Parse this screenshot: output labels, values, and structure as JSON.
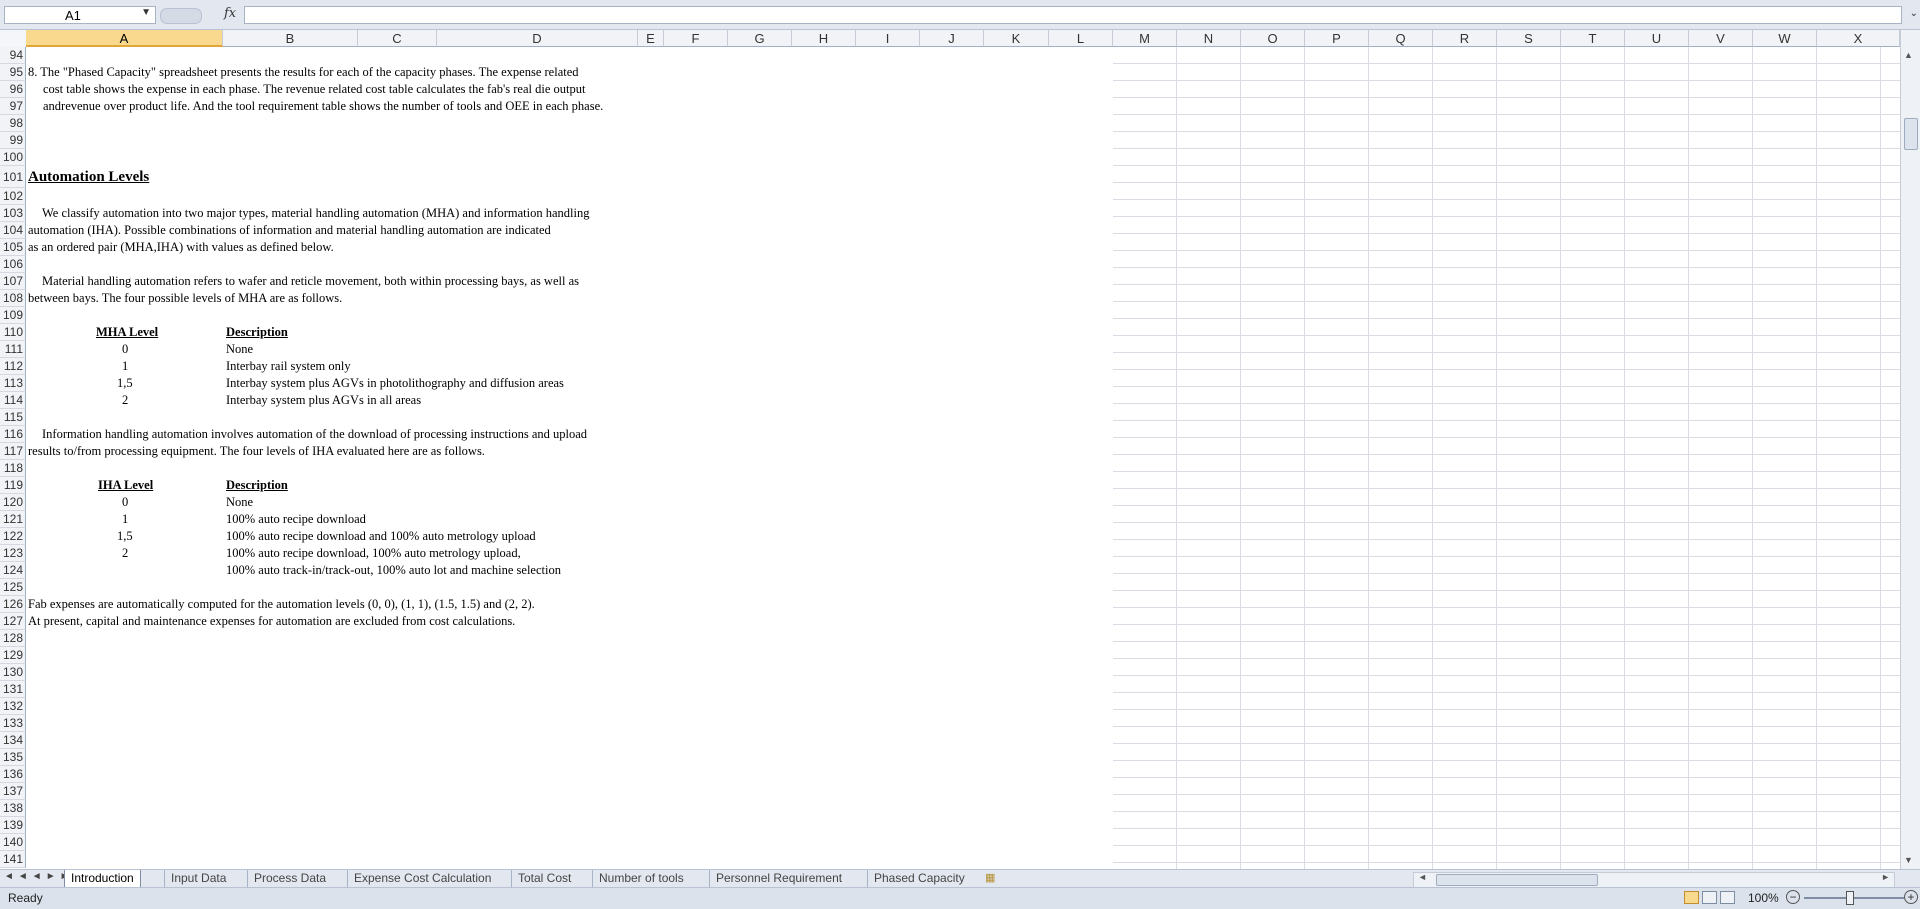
{
  "formula_bar": {
    "name_box": "A1",
    "fx": "fx",
    "formula": ""
  },
  "columns": [
    "A",
    "B",
    "C",
    "D",
    "E",
    "F",
    "G",
    "H",
    "I",
    "J",
    "K",
    "L",
    "M",
    "N",
    "O",
    "P",
    "Q",
    "R",
    "S",
    "T",
    "U",
    "V",
    "W",
    "X"
  ],
  "rows": [
    "94",
    "95",
    "96",
    "97",
    "98",
    "99",
    "100",
    "101",
    "102",
    "103",
    "104",
    "105",
    "106",
    "107",
    "108",
    "109",
    "110",
    "111",
    "112",
    "113",
    "114",
    "115",
    "116",
    "117",
    "118",
    "119",
    "120",
    "121",
    "122",
    "123",
    "124",
    "125",
    "126",
    "127",
    "128",
    "129",
    "130",
    "131",
    "132",
    "133",
    "134",
    "135",
    "136",
    "137",
    "138",
    "139",
    "140",
    "141"
  ],
  "content": {
    "r95": "8.  The \"Phased Capacity\" spreadsheet presents the results for each of the capacity phases. The expense related",
    "r96": "cost table shows the expense in each phase. The revenue related cost table calculates the fab's real die output",
    "r97": "andrevenue over product life. And the tool requirement table shows the number of tools and OEE in each phase.",
    "heading": "Automation Levels",
    "r103": "We classify automation into two major types, material handling automation (MHA) and information handling",
    "r104": "automation (IHA).  Possible combinations of information and material handling automation are indicated",
    "r105": "as an ordered pair (MHA,IHA) with values as defined below.",
    "r107": "Material handling automation refers to wafer and reticle movement, both within processing bays, as well as",
    "r108": "between bays. The four possible levels of MHA are as follows.",
    "mha_header": "MHA Level",
    "desc_header": "Description",
    "mha": [
      {
        "level": "0",
        "desc": "None"
      },
      {
        "level": "1",
        "desc": "Interbay rail system only"
      },
      {
        "level": "1,5",
        "desc": "Interbay system plus AGVs in photolithography and diffusion areas"
      },
      {
        "level": "2",
        "desc": "Interbay system plus AGVs in all areas"
      }
    ],
    "r116": "Information handling automation involves automation of the download of processing instructions and upload",
    "r117": "results to/from processing equipment. The four levels of IHA evaluated here are as follows.",
    "iha_header": "IHA Level",
    "iha": [
      {
        "level": "0",
        "desc": "None"
      },
      {
        "level": "1",
        "desc": "100%  auto recipe download"
      },
      {
        "level": "1,5",
        "desc": "100%  auto recipe download and 100% auto metrology upload"
      },
      {
        "level": "2",
        "desc": "100%  auto recipe download, 100% auto metrology upload,"
      }
    ],
    "r124": "100% auto track-in/track-out, 100% auto lot and machine selection",
    "r126": "Fab expenses are automatically computed for the automation levels (0, 0), (1, 1), (1.5, 1.5) and (2, 2).",
    "r127": "At present, capital and maintenance expenses for automation are excluded from cost calculations."
  },
  "tabs": [
    "Introduction",
    "Input Data",
    "Process Data",
    "Expense Cost Calculation",
    "Total Cost",
    "Number of tools",
    "Personnel Requirement",
    "Phased Capacity"
  ],
  "active_tab": "Introduction",
  "status": {
    "ready": "Ready",
    "zoom": "100%"
  }
}
